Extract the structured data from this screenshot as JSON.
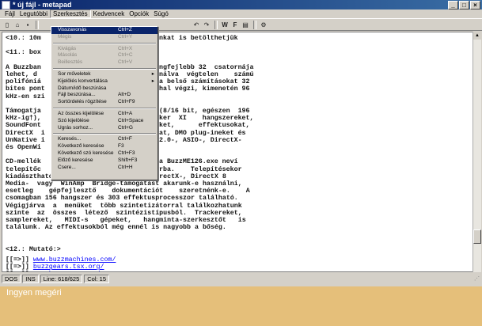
{
  "window": {
    "title": "* új fájl - metapad"
  },
  "menubar": [
    "Fájl",
    "Legutóbbi",
    "Szerkesztés",
    "Kedvencek",
    "Opciók",
    "Súgó"
  ],
  "toolbar": {
    "icons": [
      "new-icon",
      "open-icon",
      "save-icon",
      "undo-icon",
      "redo-icon",
      "word-wrap-icon",
      "font-icon",
      "preview-icon",
      "settings-icon"
    ]
  },
  "editor": {
    "lines": [
      "<10.: 10m",
      "",
      "<11.: box",
      "",
      "A Buzzban",
      "lehet, d",
      "polifóniá",
      "bites pont",
      "kHz-en szi",
      "",
      "Támogatja",
      "kHz-ig†),",
      "SoundFont",
      "DirectX  i",
      "UnNative i",
      "és OpenWi",
      "",
      "CD-mellék",
      "telepítőc",
      "kiadásztható, hogy Buzz 1.2-t, VST-, DirectX-, DirectX 8",
      "Media-  vagy  WinAmp  Bridge-támogatást akarunk-e használni,",
      "esetleg    gépfejlesztő    dokumentációt    szeretnénk-e.    A",
      "csomagban 156 hangszer és 303 effektusprocesszor található.",
      "Végigjárva  a  menüket  több szintetizátorral találkozhatunk",
      "szinte  az  összes  létező  szintézistípusból.  Trackereket,",
      "samplereket,   MIDI-s   gépeket,   hangminta-szerkesztőt   is",
      "találunk. Az effektusokból még ennél is nagyobb a bőség.",
      "",
      "",
      "<12.: Mutató:>",
      ""
    ],
    "right_lines": [
      "nkat is betölthetjük",
      "",
      "",
      "",
      "ngfejlebb 32  csatornája",
      "nálva  végtelen    számú",
      "a belső számításokat 32",
      "hal végzi, kimenetén 96",
      "",
      "",
      "(8/16 bit, egészen  196",
      "ker  XI    hangszereket,",
      "ket,      effektusokat,",
      "at, DMO plug-ineket és",
      "2.0-, ASIO-, DirectX-",
      "",
      "",
      "a BuzzME126.exe neví",
      "rba.    Telepítésekor"
    ],
    "links": [
      {
        "prefix": "[[=>]] ",
        "text": "www.buzzmachines.com/"
      },
      {
        "prefix": "[[=>]] ",
        "text": "buzzgears.tsx.org/"
      },
      {
        "prefix": "[[=>]] ",
        "text": "www.buzzscene.ca/"
      },
      {
        "prefix": "[[=>]] ",
        "text": "www.cyanwerks.com/"
      },
      {
        "prefix": "[[=>]] ",
        "text": "www.scene.de/djlaser"
      }
    ]
  },
  "menu": {
    "items": [
      {
        "label": "Visszavonás",
        "shortcut": "Ctrl+Z",
        "enabled": true,
        "highlight": true
      },
      {
        "label": "Mégis",
        "shortcut": "Ctrl+Y",
        "enabled": false
      },
      {
        "sep": true
      },
      {
        "label": "Kivágás",
        "shortcut": "Ctrl+X",
        "enabled": false
      },
      {
        "label": "Másolás",
        "shortcut": "Ctrl+C",
        "enabled": false
      },
      {
        "label": "Beillesztés",
        "shortcut": "Ctrl+V",
        "enabled": false
      },
      {
        "sep": true
      },
      {
        "label": "Sor műveletek",
        "shortcut": "",
        "enabled": true,
        "submenu": true
      },
      {
        "label": "Kijelölés konvertálása",
        "shortcut": "",
        "enabled": true,
        "submenu": true
      },
      {
        "label": "Dátum/idő beszúrása",
        "shortcut": "",
        "enabled": true
      },
      {
        "label": "Fájl beszúrása...",
        "shortcut": "Alt+D",
        "enabled": true
      },
      {
        "label": "Sortördelés rögzítése",
        "shortcut": "Ctrl+F9",
        "enabled": true
      },
      {
        "sep": true
      },
      {
        "label": "Az összes kijelölése",
        "shortcut": "Ctrl+A",
        "enabled": true
      },
      {
        "label": "Szó kijelölése",
        "shortcut": "Ctrl+Space",
        "enabled": true
      },
      {
        "label": "Ugrás sorhoz...",
        "shortcut": "Ctrl+G",
        "enabled": true
      },
      {
        "sep": true
      },
      {
        "label": "Keresés...",
        "shortcut": "Ctrl+F",
        "enabled": true
      },
      {
        "label": "Következő keresése",
        "shortcut": "F3",
        "enabled": true
      },
      {
        "label": "Következő szó keresése",
        "shortcut": "Ctrl+F3",
        "enabled": true
      },
      {
        "label": "Előző keresése",
        "shortcut": "Shift+F3",
        "enabled": true
      },
      {
        "label": "Csere...",
        "shortcut": "Ctrl+H",
        "enabled": true
      }
    ]
  },
  "statusbar": {
    "mode": "DOS",
    "ins": "INS",
    "line": "Line: 618/625",
    "col": "Col: 15"
  },
  "caption": "Ingyen megéri"
}
